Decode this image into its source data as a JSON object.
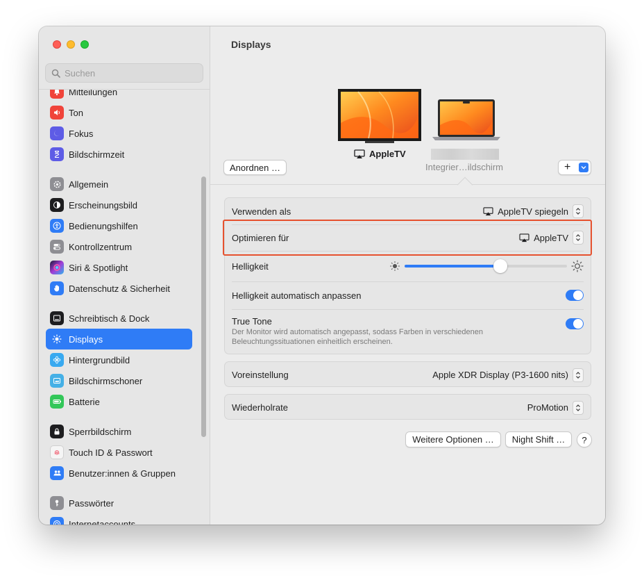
{
  "window": {
    "traffic": [
      "close",
      "minimize",
      "zoom"
    ]
  },
  "search": {
    "placeholder": "Suchen"
  },
  "sidebar": {
    "items": [
      {
        "label": "Mitteilungen",
        "icon": "bell-icon",
        "color": "#f0443a"
      },
      {
        "label": "Ton",
        "icon": "speaker-icon",
        "color": "#f0443a"
      },
      {
        "label": "Fokus",
        "icon": "moon-icon",
        "color": "#5e5ce6"
      },
      {
        "label": "Bildschirmzeit",
        "icon": "hourglass-icon",
        "color": "#5e5ce6"
      },
      {
        "label": "Allgemein",
        "icon": "gear-icon",
        "color": "#8e8e93"
      },
      {
        "label": "Erscheinungsbild",
        "icon": "appearance-icon",
        "color": "#1d1d1f"
      },
      {
        "label": "Bedienungshilfen",
        "icon": "accessibility-icon",
        "color": "#2f7cf6"
      },
      {
        "label": "Kontrollzentrum",
        "icon": "toggles-icon",
        "color": "#8e8e93"
      },
      {
        "label": "Siri & Spotlight",
        "icon": "siri-icon",
        "color": "#a43bd6"
      },
      {
        "label": "Datenschutz & Sicherheit",
        "icon": "hand-icon",
        "color": "#2f7cf6"
      },
      {
        "label": "Schreibtisch & Dock",
        "icon": "dock-icon",
        "color": "#1d1d1f"
      },
      {
        "label": "Displays",
        "icon": "sun-icon",
        "color": "#2f7cf6",
        "active": true
      },
      {
        "label": "Hintergrundbild",
        "icon": "flower-icon",
        "color": "#38a9f0"
      },
      {
        "label": "Bildschirmschoner",
        "icon": "screensaver-icon",
        "color": "#45b0e6"
      },
      {
        "label": "Batterie",
        "icon": "battery-icon",
        "color": "#33c759"
      },
      {
        "label": "Sperrbildschirm",
        "icon": "lock-icon",
        "color": "#1d1d1f"
      },
      {
        "label": "Touch ID & Passwort",
        "icon": "fingerprint-icon",
        "color": "#f5f5f5"
      },
      {
        "label": "Benutzer:innen & Gruppen",
        "icon": "users-icon",
        "color": "#2f7cf6"
      },
      {
        "label": "Passwörter",
        "icon": "key-icon",
        "color": "#8e8e93"
      },
      {
        "label": "Internetaccounts",
        "icon": "at-icon",
        "color": "#2f7cf6"
      }
    ]
  },
  "content": {
    "title": "Displays",
    "arrange_button": "Anordnen …",
    "appletv_label": "AppleTV",
    "integrated_label": "Integrier…ildschirm",
    "add_button": "+",
    "settings": {
      "use_as": {
        "label": "Verwenden als",
        "value": "AppleTV spiegeln"
      },
      "optimize_for": {
        "label": "Optimieren für",
        "value": "AppleTV"
      },
      "brightness": {
        "label": "Helligkeit",
        "level": 0.6
      },
      "auto_brightness": {
        "label": "Helligkeit automatisch anpassen",
        "on": true
      },
      "true_tone": {
        "label": "True Tone",
        "description": "Der Monitor wird automatisch angepasst, sodass Farben in verschiedenen Beleuchtungssituationen einheitlich erscheinen.",
        "on": true
      },
      "preset": {
        "label": "Voreinstellung",
        "value": "Apple XDR Display (P3-1600 nits)"
      },
      "refresh_rate": {
        "label": "Wiederholrate",
        "value": "ProMotion"
      }
    },
    "footer": {
      "more_options": "Weitere Optionen …",
      "night_shift": "Night Shift …",
      "help": "?"
    }
  },
  "colors": {
    "accent": "#2f7cf6",
    "highlight_border": "#e6512e"
  }
}
